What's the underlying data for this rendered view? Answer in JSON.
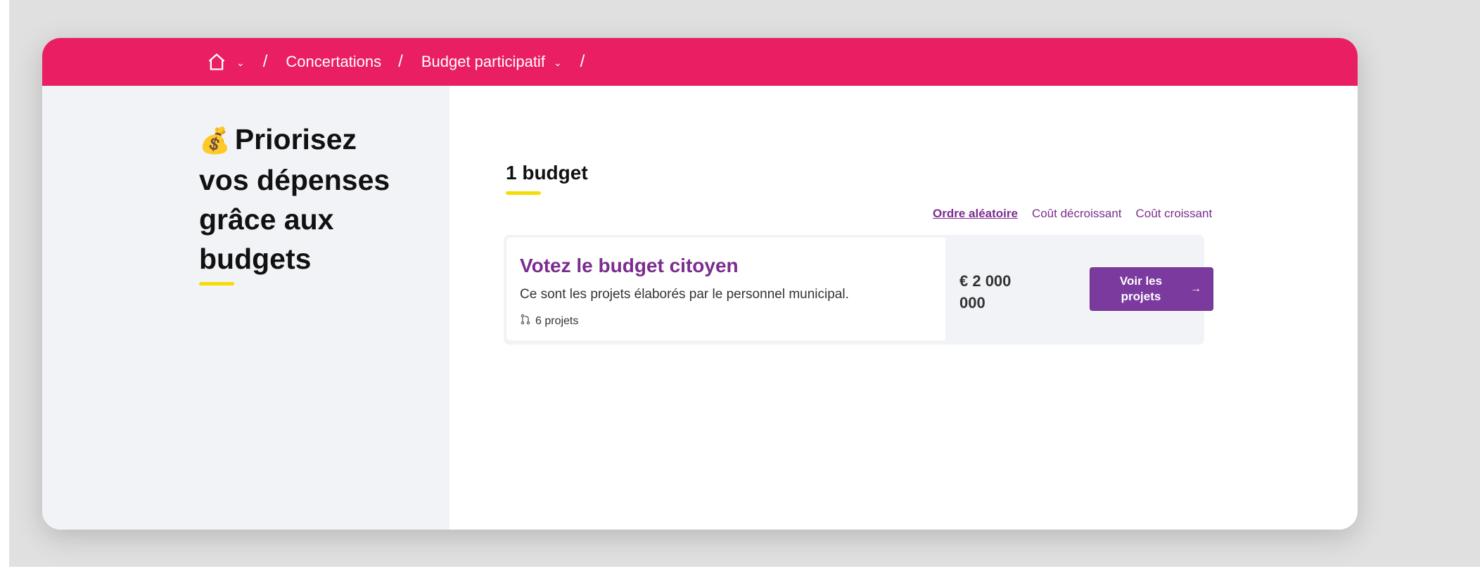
{
  "breadcrumb": {
    "home_icon": "home-icon",
    "items": [
      "Concertations",
      "Budget participatif"
    ],
    "separator": "/"
  },
  "heading": {
    "emoji": "💰",
    "line1": "Priorisez",
    "line2": "vos dépenses",
    "line3": "grâce aux",
    "line4": "budgets"
  },
  "budget_count": "1 budget",
  "sort": {
    "options": [
      "Ordre aléatoire",
      "Coût décroissant",
      "Coût croissant"
    ],
    "active": "Ordre aléatoire"
  },
  "budget_card": {
    "title": "Votez le budget citoyen",
    "description": "Ce sont les projets élaborés par le personnel municipal.",
    "projects_count": "6 projets",
    "amount_line1": "€ 2 000",
    "amount_line2": "000",
    "button_label": "Voir les projets"
  },
  "colors": {
    "topbar": "#e91e63",
    "accent": "#7b2d8e",
    "highlight": "#f6dc00"
  }
}
